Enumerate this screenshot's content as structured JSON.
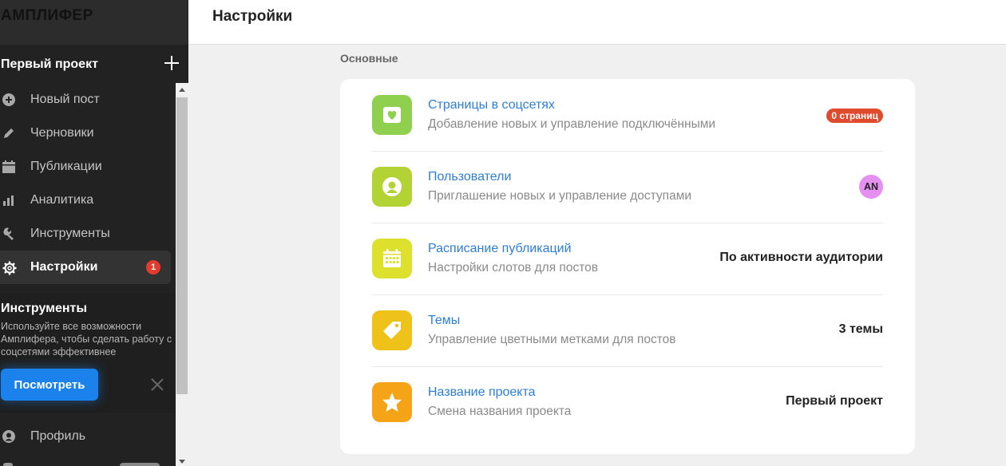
{
  "app": {
    "logo": "АМПЛИФЕР"
  },
  "sidebar": {
    "project_name": "Первый проект",
    "items": [
      {
        "label": "Новый пост",
        "icon": "plus-circle-icon"
      },
      {
        "label": "Черновики",
        "icon": "pencil-icon"
      },
      {
        "label": "Публикации",
        "icon": "calendar-icon"
      },
      {
        "label": "Аналитика",
        "icon": "bar-chart-icon"
      },
      {
        "label": "Инструменты",
        "icon": "wrench-icon"
      },
      {
        "label": "Настройки",
        "icon": "gear-icon",
        "active": true,
        "badge": "1"
      }
    ],
    "promo": {
      "title": "Инструменты",
      "text": "Используйте все возможности Амплифера, чтобы сделать работу с соцсетями эффективнее",
      "button": "Посмотреть"
    },
    "profile_label": "Профиль"
  },
  "header": {
    "title": "Настройки"
  },
  "main": {
    "section_label": "Основные",
    "rows": [
      {
        "title": "Страницы в соцсетях",
        "subtitle": "Добавление новых и управление подключёнными",
        "badge": "0 страниц",
        "icon": "heart-icon",
        "color": "#8fd14f"
      },
      {
        "title": "Пользователи",
        "subtitle": "Приглашение новых и управление доступами",
        "avatar": "AN",
        "icon": "user-icon",
        "color": "#b3d334"
      },
      {
        "title": "Расписание публикаций",
        "subtitle": "Настройки слотов для постов",
        "value": "По активности аудитории",
        "icon": "calendar-icon",
        "color": "#dde02c"
      },
      {
        "title": "Темы",
        "subtitle": "Управление цветными метками для постов",
        "value": "3 темы",
        "icon": "tag-icon",
        "color": "#efc21a"
      },
      {
        "title": "Название проекта",
        "subtitle": "Смена названия проекта",
        "value": "Первый проект",
        "icon": "star-icon",
        "color": "#f5a417"
      }
    ]
  }
}
